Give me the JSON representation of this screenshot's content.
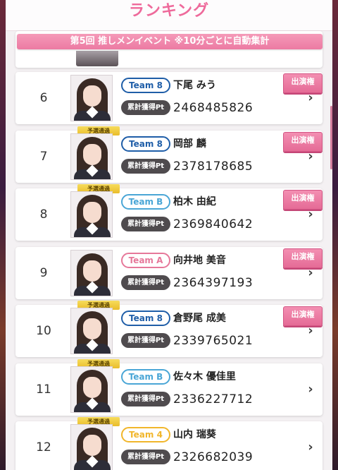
{
  "header": {
    "title": "ランキング"
  },
  "banner": {
    "text": "第5回 推しメンイベント ※10分ごとに自動集計"
  },
  "labels": {
    "pt_label": "累計獲得Pt",
    "appearance": "出演権",
    "pass_tag": "予選通過",
    "chevron": "›"
  },
  "team_colors": {
    "Team 8": "#1f5ea8",
    "Team B": "#4aa6d6",
    "Team A": "#e6789a",
    "Team 4": "#f1b62b"
  },
  "rows": [
    {
      "rank": "6",
      "team": "Team 8",
      "name": "下尾 みう",
      "points": "2468485826",
      "appearance": true,
      "pass": false
    },
    {
      "rank": "7",
      "team": "Team 8",
      "name": "岡部 麟",
      "points": "2378178685",
      "appearance": true,
      "pass": true
    },
    {
      "rank": "8",
      "team": "Team B",
      "name": "柏木 由紀",
      "points": "2369840642",
      "appearance": true,
      "pass": true
    },
    {
      "rank": "9",
      "team": "Team A",
      "name": "向井地 美音",
      "points": "2364397193",
      "appearance": true,
      "pass": false
    },
    {
      "rank": "10",
      "team": "Team 8",
      "name": "倉野尾 成美",
      "points": "2339765021",
      "appearance": true,
      "pass": true
    },
    {
      "rank": "11",
      "team": "Team B",
      "name": "佐々木 優佳里",
      "points": "2336227712",
      "appearance": false,
      "pass": true
    },
    {
      "rank": "12",
      "team": "Team 4",
      "name": "山内 瑞葵",
      "points": "2326682039",
      "appearance": false,
      "pass": true
    }
  ]
}
